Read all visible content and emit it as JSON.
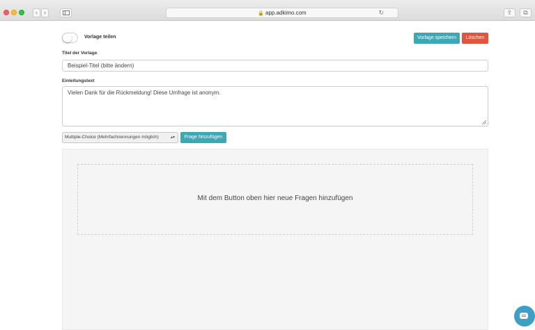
{
  "browser": {
    "url": "app.adkimo.com",
    "lock_glyph": "🔒",
    "back_glyph": "‹",
    "forward_glyph": "›",
    "reload_glyph": "↻",
    "share_glyph": "⇪",
    "tabs_glyph": "⧉"
  },
  "form": {
    "share_toggle": {
      "label": "Vorlage teilen",
      "checked": false
    },
    "save_button": "Vorlage speichern",
    "delete_button": "Löschen",
    "title_label": "Titel der Vorlage",
    "title_value": "Beispiel-Titel (bitte ändern)",
    "intro_label": "Einleitungstext",
    "intro_value": "Vielen Dank für die Rückmeldung! Diese Umfrage ist anonym.",
    "question_type_selected": "Multiple-Choice (Mehrfachnennungen möglich)",
    "add_question_button": "Frage hinzufügen",
    "empty_hint": "Mit dem Button oben hier neue Fragen hinzufügen"
  },
  "colors": {
    "primary": "#3ea7b6",
    "danger": "#e3533d",
    "chat": "#3e9fc6"
  }
}
